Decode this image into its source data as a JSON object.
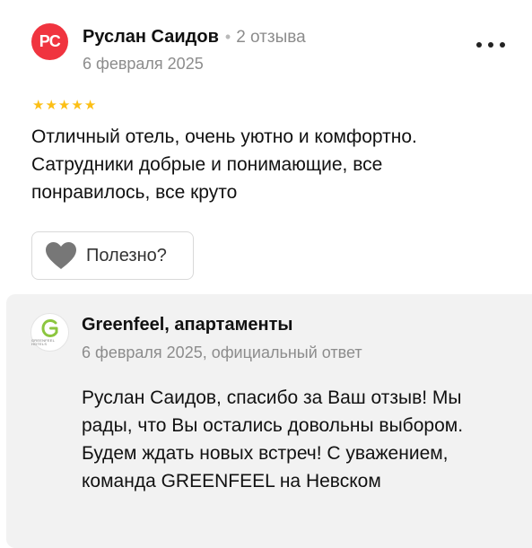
{
  "review": {
    "author_initials": "РС",
    "author_name": "Руслан Саидов",
    "separator": "•",
    "review_count": "2 отзыва",
    "date": "6 февраля 2025",
    "rating": 5,
    "rating_max": 5,
    "text": "Отличный отель, очень уютно и комфортно. Сатрудники добрые и понимающие, все понравилось, все круто",
    "helpful_label": "Полезно?"
  },
  "reply": {
    "org_name": "Greenfeel, апартаменты",
    "logo_letter": "G",
    "logo_caption": "GREENFEEL HOTELS",
    "meta": "6 февраля 2025, официальный ответ",
    "text": "Руслан Саидов, спасибо за Ваш отзыв! Мы рады, что Вы остались довольны выбором. Будем ждать новых встреч! С уважением, команда GREENFEEL на Невском"
  },
  "colors": {
    "avatar_bg": "#f0343f",
    "star": "#fcbf15",
    "muted_text": "#8c8c8c",
    "reply_bg": "#f2f2f2",
    "brand_green": "#8cc63f"
  },
  "icons": {
    "more": "more-dots-icon",
    "helpful": "heart-icon",
    "star": "star-icon"
  }
}
